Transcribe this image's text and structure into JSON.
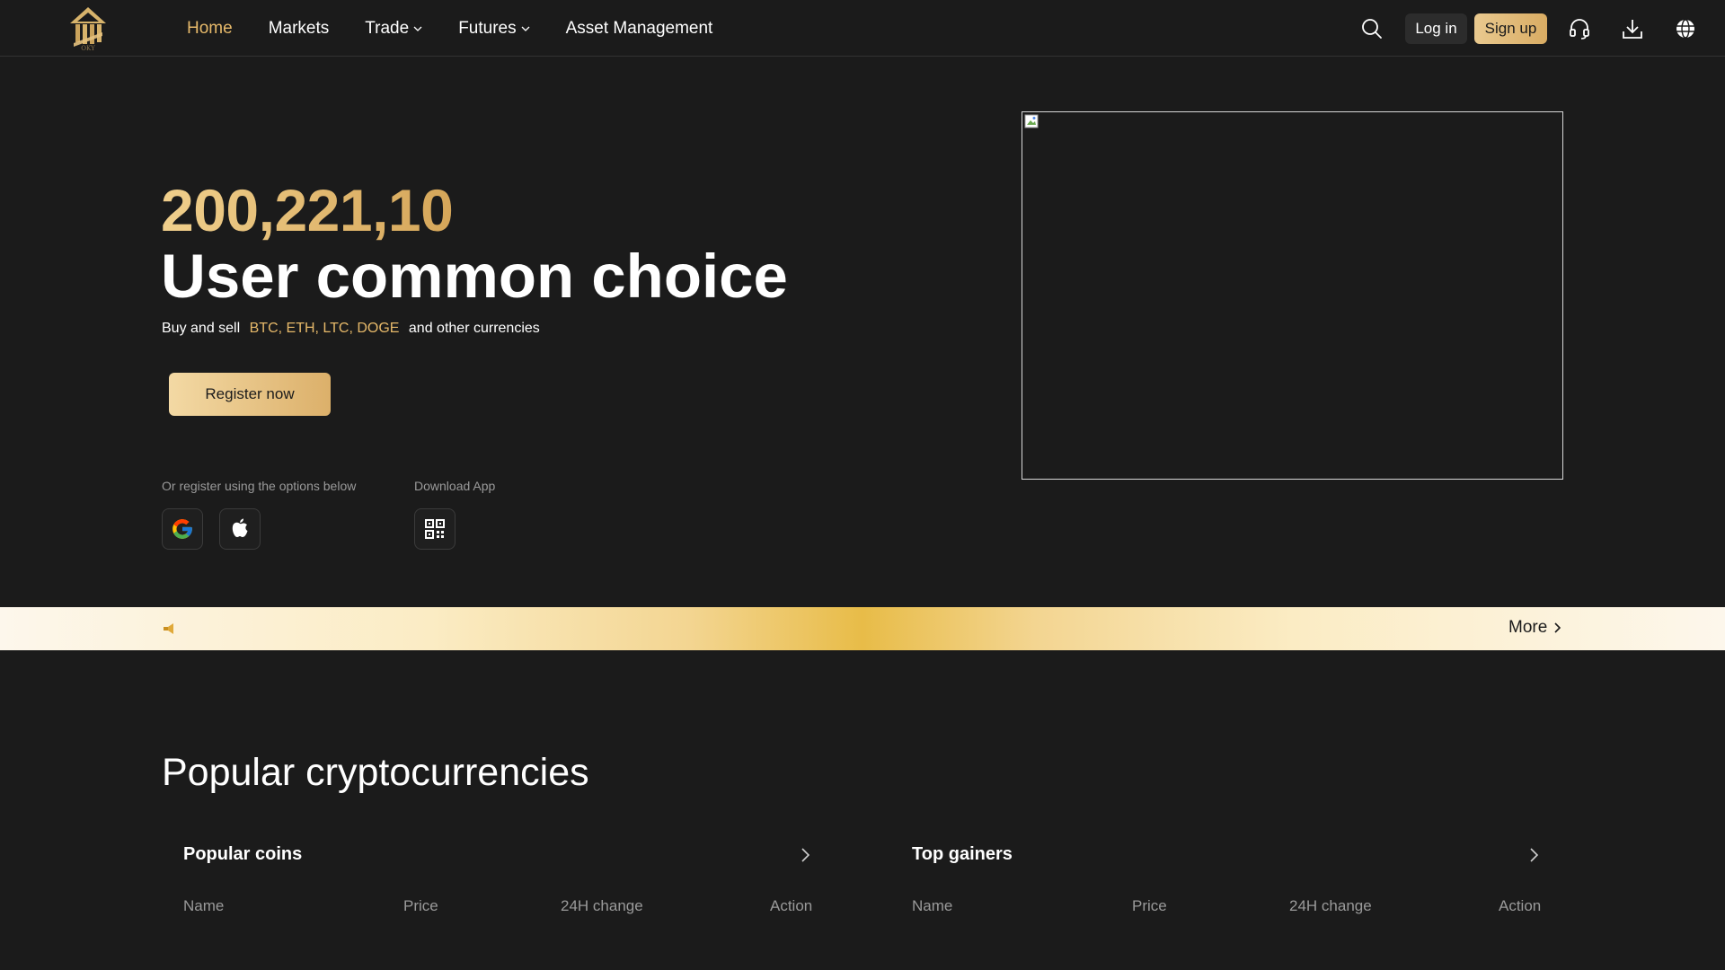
{
  "header": {
    "logo_text": "OKY",
    "nav": [
      {
        "label": "Home",
        "active": true,
        "dropdown": false
      },
      {
        "label": "Markets",
        "active": false,
        "dropdown": false
      },
      {
        "label": "Trade",
        "active": false,
        "dropdown": true
      },
      {
        "label": "Futures",
        "active": false,
        "dropdown": true
      },
      {
        "label": "Asset Management",
        "active": false,
        "dropdown": false
      }
    ],
    "login_label": "Log in",
    "signup_label": "Sign up",
    "icons": [
      "search-icon",
      "headset-icon",
      "download-icon",
      "globe-icon"
    ]
  },
  "hero": {
    "number": "200,221,10",
    "title": "User common choice",
    "subtitle_prefix": "Buy and sell",
    "subtitle_coins": "BTC, ETH, LTC, DOGE",
    "subtitle_suffix": "and other currencies",
    "register_label": "Register now",
    "register_options_label": "Or register using the options below",
    "download_label": "Download App"
  },
  "announcement": {
    "more_label": "More"
  },
  "popular": {
    "title": "Popular cryptocurrencies",
    "panels": [
      {
        "title": "Popular coins",
        "columns": [
          "Name",
          "Price",
          "24H change",
          "Action"
        ]
      },
      {
        "title": "Top gainers",
        "columns": [
          "Name",
          "Price",
          "24H change",
          "Action"
        ]
      }
    ]
  },
  "colors": {
    "background": "#1b1b1b",
    "accent_gold": "#e6b96a",
    "muted_text": "#9a9a9a"
  }
}
